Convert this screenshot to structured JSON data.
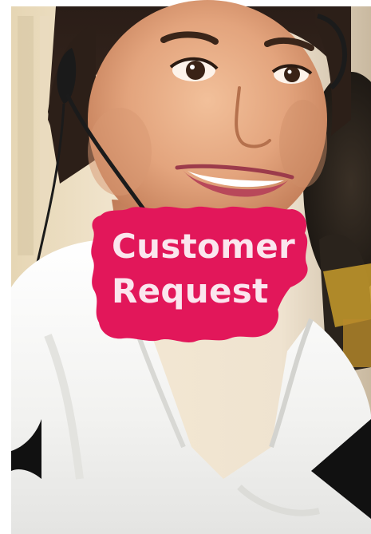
{
  "badge": {
    "line1": "Customer",
    "line2": "Request",
    "color": "#e2175a"
  },
  "photo": {
    "subject": "smiling-woman-with-headset-icon"
  }
}
